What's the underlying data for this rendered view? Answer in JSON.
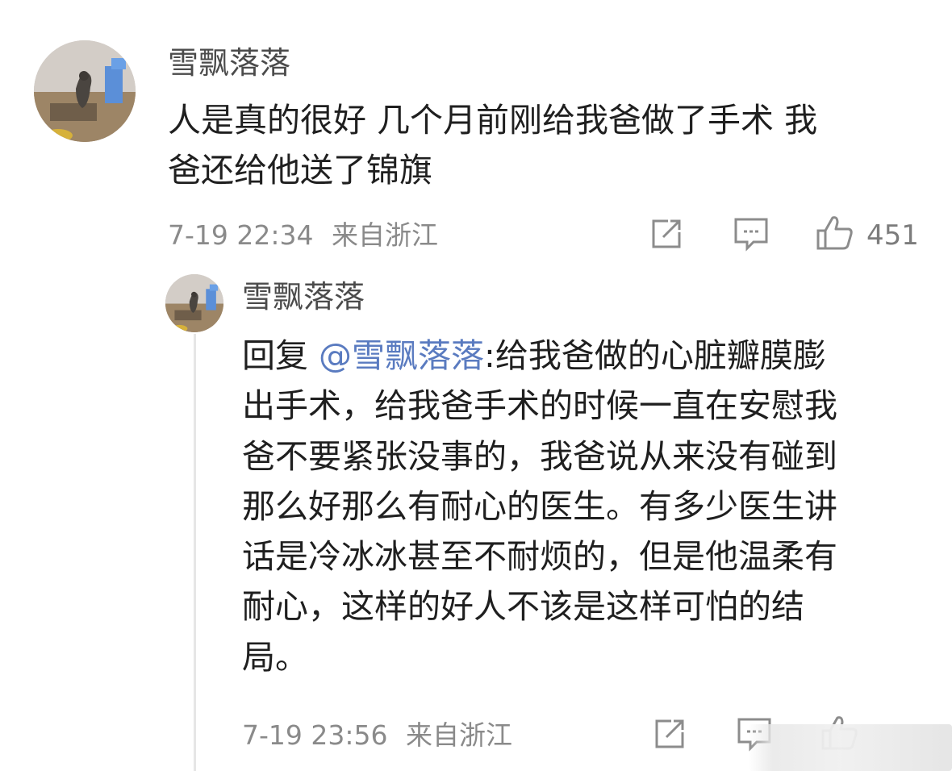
{
  "comment": {
    "username": "雪飘落落",
    "text_line1": "人是真的很好 几个月前刚给我爸做了手术 我",
    "text_line2": "爸还给他送了锦旗",
    "timestamp": "7-19 22:34",
    "location": "来自浙江",
    "like_count": "451",
    "icons": [
      "share-icon",
      "comment-icon",
      "like-icon"
    ]
  },
  "reply": {
    "username": "雪飘落落",
    "prefix": "回复 ",
    "mention": "@雪飘落落",
    "line1_rest": ":给我爸做的心脏瓣膜膨",
    "line2": "出手术，给我爸手术的时候一直在安慰我",
    "line3": "爸不要紧张没事的，我爸说从来没有碰到",
    "line4": "那么好那么有耐心的医生。有多少医生讲",
    "line5": "话是冷冰冰甚至不耐烦的，但是他温柔有",
    "line6": "耐心，这样的好人不该是这样可怕的结",
    "line7": "局。",
    "timestamp": "7-19 23:56",
    "location": "来自浙江",
    "icons": [
      "share-icon",
      "comment-icon",
      "like-icon"
    ]
  },
  "colors": {
    "username": "#4b4b4b",
    "text": "#1f1f1f",
    "meta": "#8a8a8a",
    "mention": "#5a7bc0",
    "icon": "#8c8c8c",
    "thread_line": "#e6e6e6"
  }
}
